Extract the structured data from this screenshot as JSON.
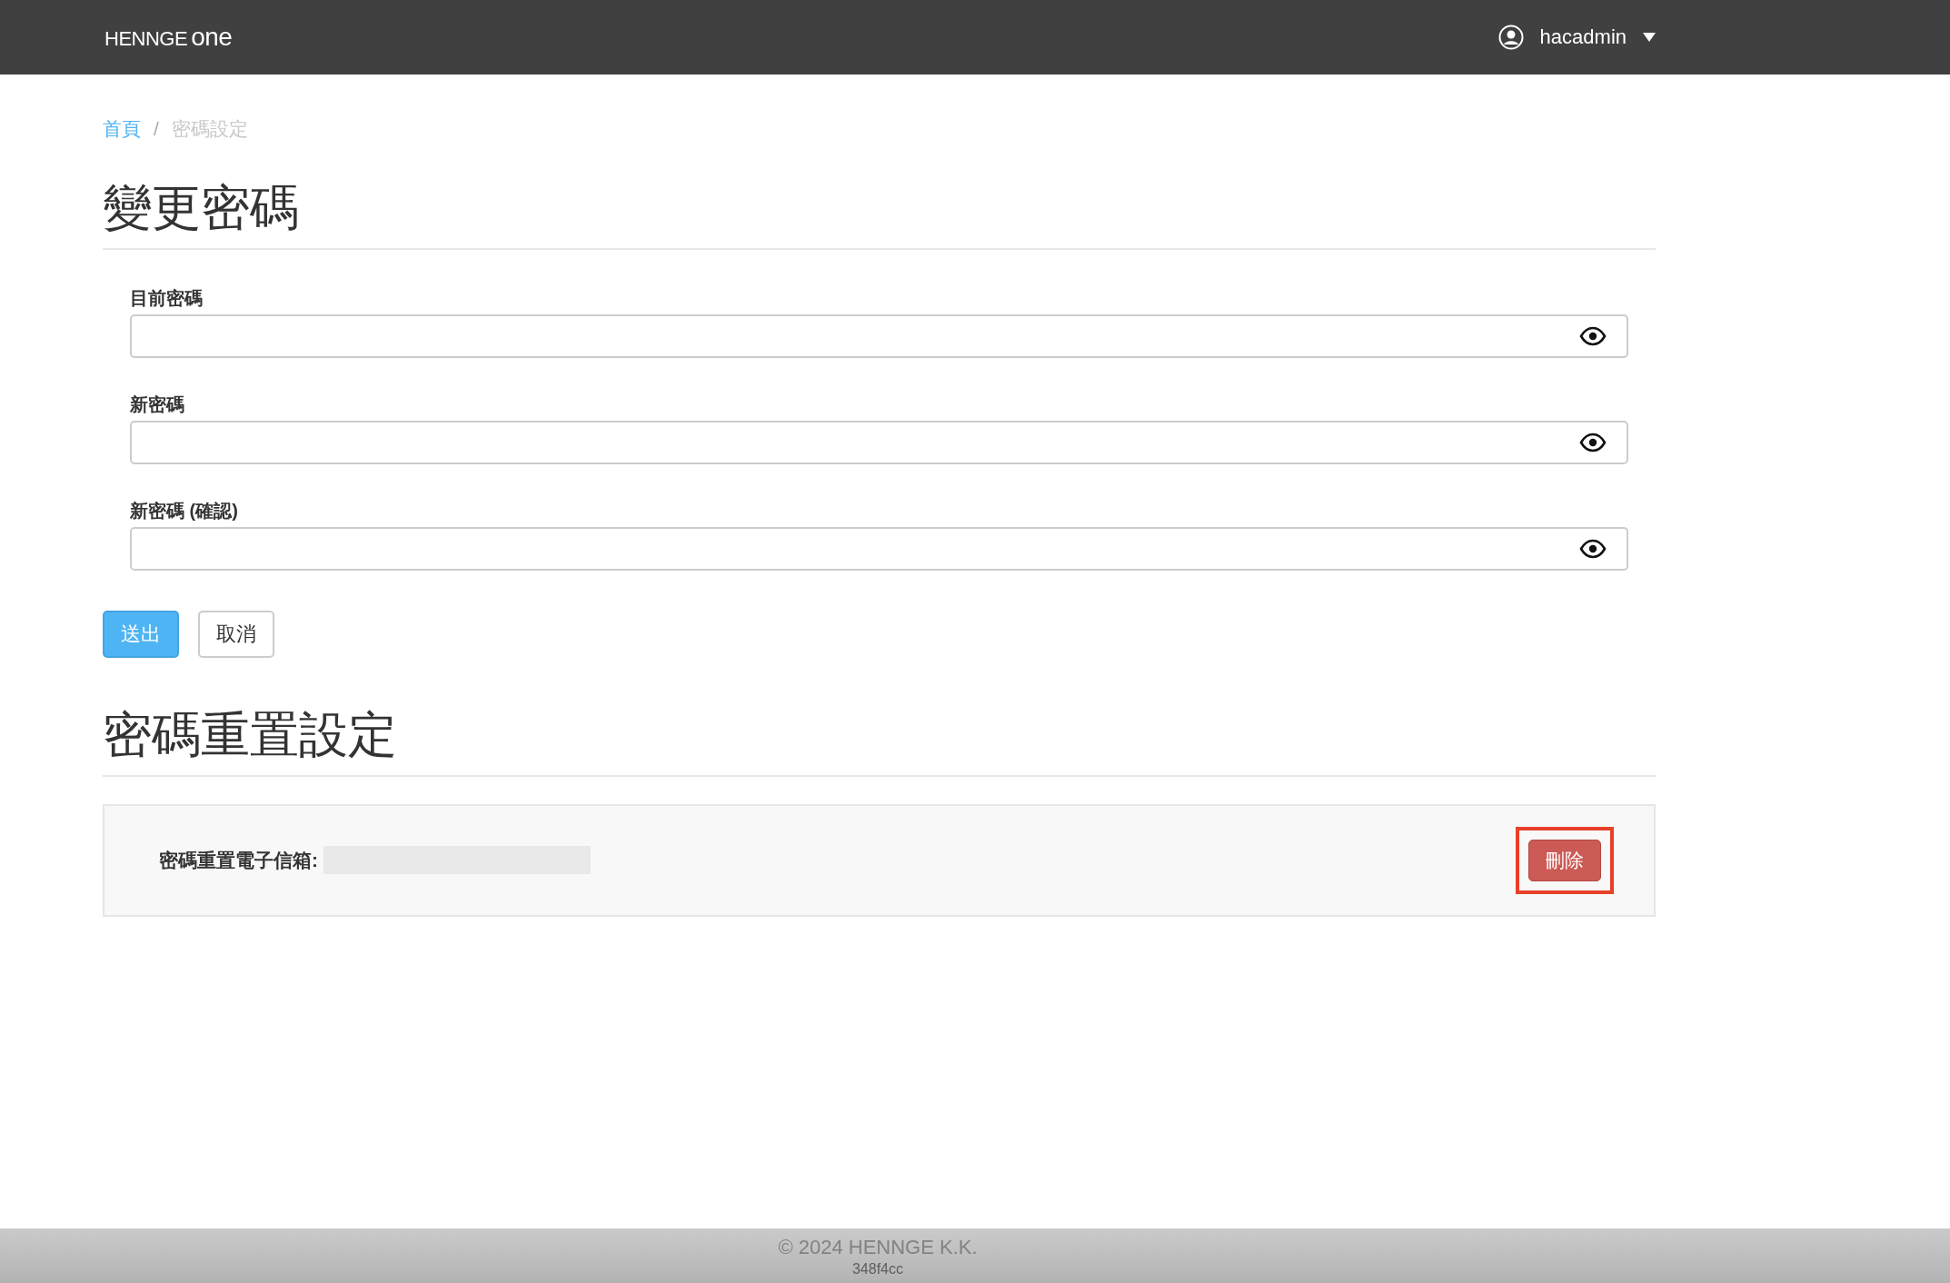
{
  "header": {
    "logo": {
      "brand": "HENNGE",
      "product": "one"
    },
    "user": "hacadmin"
  },
  "breadcrumb_separator": "/",
  "breadcrumb": [
    {
      "label": "首頁",
      "kind": "link"
    },
    {
      "label": "密碼設定",
      "kind": "current"
    }
  ],
  "change_password": {
    "title": "變更密碼",
    "fields": [
      {
        "label": "目前密碼"
      },
      {
        "label": "新密碼"
      },
      {
        "label": "新密碼 (確認)"
      }
    ],
    "buttons": [
      {
        "label": "送出",
        "kind": "primary"
      },
      {
        "label": "取消",
        "kind": "default"
      }
    ]
  },
  "reset": {
    "title": "密碼重置設定",
    "email_label": "密碼重置電子信箱:",
    "email_redacted": true,
    "delete_button": {
      "label": "刪除",
      "highlighted": true
    }
  },
  "footer": {
    "copyright": "© 2024 HENNGE K.K.",
    "build": "348f4cc"
  }
}
